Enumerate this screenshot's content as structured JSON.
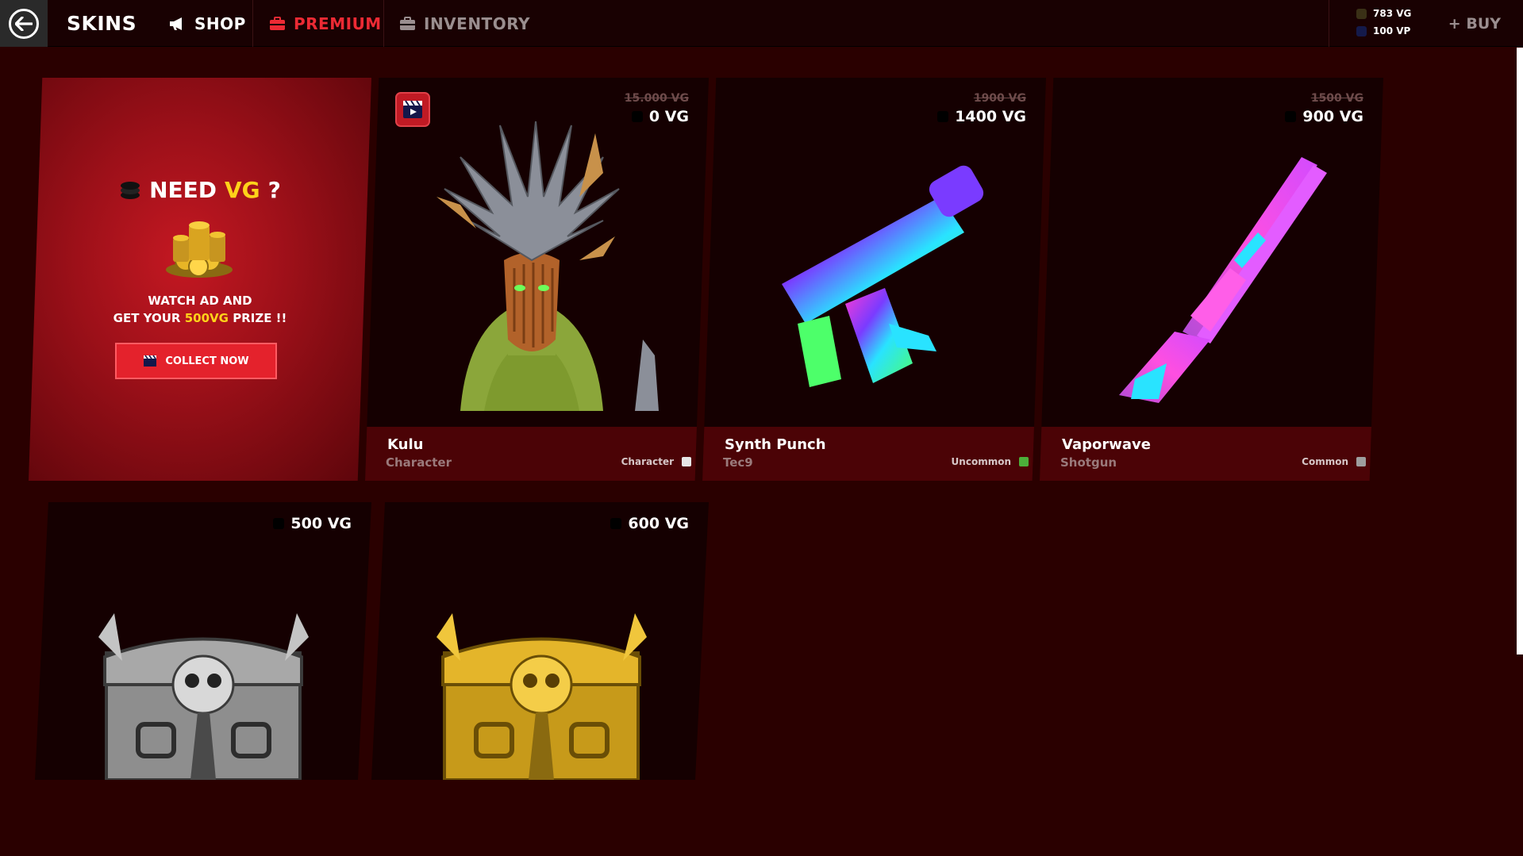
{
  "header": {
    "title": "SKINS",
    "tabs": [
      {
        "label": "SHOP",
        "icon": "megaphone-icon"
      },
      {
        "label": "PREMIUM",
        "icon": "briefcase-icon",
        "active": true
      },
      {
        "label": "INVENTORY",
        "icon": "briefcase-icon"
      }
    ],
    "currency": {
      "vg": "783 VG",
      "vp": "100 VP"
    },
    "buy_label": "+ BUY"
  },
  "promo": {
    "title_prefix": "NEED",
    "title_highlight": "VG",
    "title_suffix": "?",
    "line1": "WATCH AD AND",
    "line2_prefix": "GET YOUR",
    "line2_highlight": "500VG",
    "line2_suffix": "PRIZE !!",
    "button_label": "COLLECT NOW"
  },
  "items": [
    {
      "name": "Kulu",
      "type": "Character",
      "rarity": "Character",
      "rarity_color": "#e6e6e6",
      "old_price": "15.000 VG",
      "price": "0 VG",
      "has_video": true
    },
    {
      "name": "Synth Punch",
      "type": "Tec9",
      "rarity": "Uncommon",
      "rarity_color": "#4caf3a",
      "old_price": "1900 VG",
      "price": "1400 VG"
    },
    {
      "name": "Vaporwave",
      "type": "Shotgun",
      "rarity": "Common",
      "rarity_color": "#9e9e9e",
      "old_price": "1500 VG",
      "price": "900 VG"
    },
    {
      "name": "Silver Chest",
      "price": "500 VG"
    },
    {
      "name": "Gold Chest",
      "price": "600 VG"
    }
  ],
  "colors": {
    "accent": "#ec2a34",
    "highlight": "#ffd21a",
    "background": "#2a0000",
    "card": "#150001",
    "info_bar": "#4b0306"
  }
}
